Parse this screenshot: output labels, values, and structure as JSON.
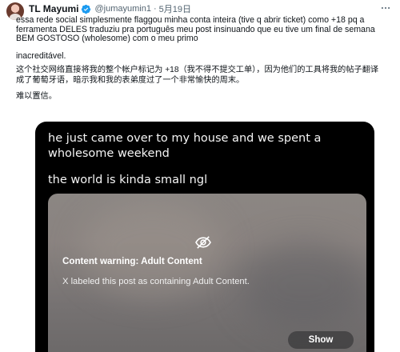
{
  "tweet": {
    "author_name": "TL Mayumi",
    "handle": "@jumayumin1",
    "separator": "·",
    "date": "5月19日",
    "text_pt": "essa rede social simplesmente flaggou minha conta inteira (tive q abrir ticket) como +18 pq a ferramenta DELES traduziu pra português meu post insinuando que eu tive um final de semana BEM GOSTOSO (wholesome) com o meu primo",
    "text_pt2": "inacreditável.",
    "text_zh": "这个社交网络直接将我的整个帐户标记为 +18（我不得不提交工单），因为他们的工具将我的帖子翻译成了葡萄牙语，暗示我和我的表弟度过了一个非常愉快的周末。",
    "text_zh2": "难以置信。"
  },
  "media": {
    "line1": "he just came over to my house and we spent a wholesome weekend",
    "line2": "the world is kinda small ngl",
    "warning_title": "Content warning: Adult Content",
    "warning_desc": "X labeled this post as containing Adult Content.",
    "show_label": "Show"
  },
  "colors": {
    "verified": "#1d9bf0",
    "secondary_text": "#536471",
    "media_bg": "#000000"
  },
  "icons": {
    "verified": "verified-badge-icon",
    "more": "more-options-icon",
    "hidden": "eye-slash-icon"
  }
}
